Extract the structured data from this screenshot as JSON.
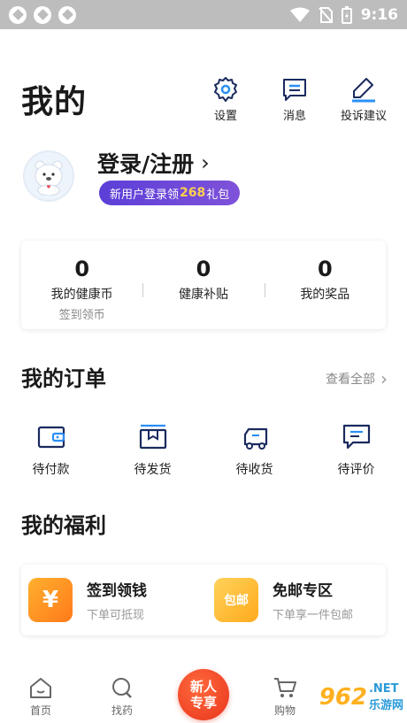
{
  "status_bar": {
    "time": "9:16"
  },
  "header": {
    "title": "我的",
    "actions": [
      {
        "label": "设置",
        "icon": "gear-icon"
      },
      {
        "label": "消息",
        "icon": "message-icon"
      },
      {
        "label": "投诉建议",
        "icon": "edit-pen-icon"
      }
    ]
  },
  "profile": {
    "login_label": "登录/注册",
    "promo": {
      "prefix": "新用户登录领",
      "amount": "268",
      "suffix": "礼包"
    }
  },
  "stats": [
    {
      "value": "0",
      "label": "我的健康币",
      "sub": "签到领币"
    },
    {
      "value": "0",
      "label": "健康补贴",
      "sub": ""
    },
    {
      "value": "0",
      "label": "我的奖品",
      "sub": ""
    }
  ],
  "orders": {
    "title": "我的订单",
    "view_all": "查看全部",
    "items": [
      {
        "label": "待付款",
        "icon": "wallet-icon"
      },
      {
        "label": "待发货",
        "icon": "package-icon"
      },
      {
        "label": "待收货",
        "icon": "truck-icon"
      },
      {
        "label": "待评价",
        "icon": "review-icon"
      }
    ]
  },
  "benefits": {
    "title": "我的福利",
    "items": [
      {
        "title": "签到领钱",
        "sub": "下单可抵现",
        "icon_text": "¥",
        "color": "#ff8a1f"
      },
      {
        "title": "免邮专区",
        "sub": "下单享一件包邮",
        "icon_text": "包邮",
        "color": "#ffb21c"
      }
    ]
  },
  "bottom_nav": {
    "items": [
      {
        "label": "首页",
        "icon": "home-icon"
      },
      {
        "label": "找药",
        "icon": "search-icon"
      },
      {
        "label": "新人专享",
        "line1": "新人",
        "line2": "专享",
        "icon": "new-user-badge"
      },
      {
        "label": "购物",
        "icon": "cart-icon"
      }
    ]
  },
  "watermark": {
    "text": "962",
    "suffix": ".NET",
    "sub": "乐游网"
  },
  "colors": {
    "accent": "#6a46d8",
    "orange": "#ff8a1f",
    "text": "#1a1a1a"
  }
}
